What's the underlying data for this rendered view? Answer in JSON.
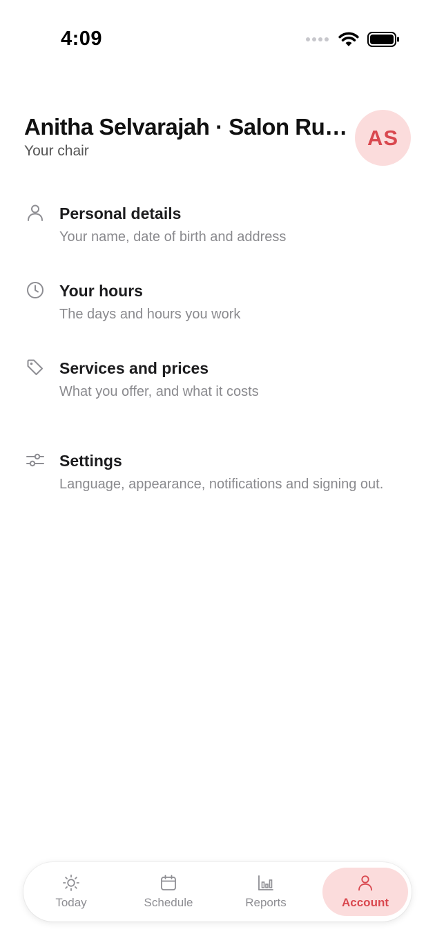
{
  "status_bar": {
    "time": "4:09"
  },
  "header": {
    "title": "Anitha Selvarajah · Salon Rue...",
    "subtitle": "Your chair",
    "avatar_initials": "AS"
  },
  "menu": {
    "items": [
      {
        "icon": "person-icon",
        "title": "Personal details",
        "description": "Your name, date of birth and address"
      },
      {
        "icon": "clock-icon",
        "title": "Your hours",
        "description": "The days and hours you work"
      },
      {
        "icon": "tag-icon",
        "title": "Services and prices",
        "description": "What you offer, and what it costs"
      },
      {
        "icon": "sliders-icon",
        "title": "Settings",
        "description": "Language, appearance, notifications and signing out."
      }
    ]
  },
  "tabbar": {
    "tabs": [
      {
        "icon": "sun-icon",
        "label": "Today",
        "active": false
      },
      {
        "icon": "calendar-icon",
        "label": "Schedule",
        "active": false
      },
      {
        "icon": "bar-chart-icon",
        "label": "Reports",
        "active": false
      },
      {
        "icon": "person-icon",
        "label": "Account",
        "active": true
      }
    ]
  },
  "colors": {
    "accent": "#d9484f",
    "accent_soft": "#fbdcdc",
    "muted_text": "#8a8a8e"
  }
}
